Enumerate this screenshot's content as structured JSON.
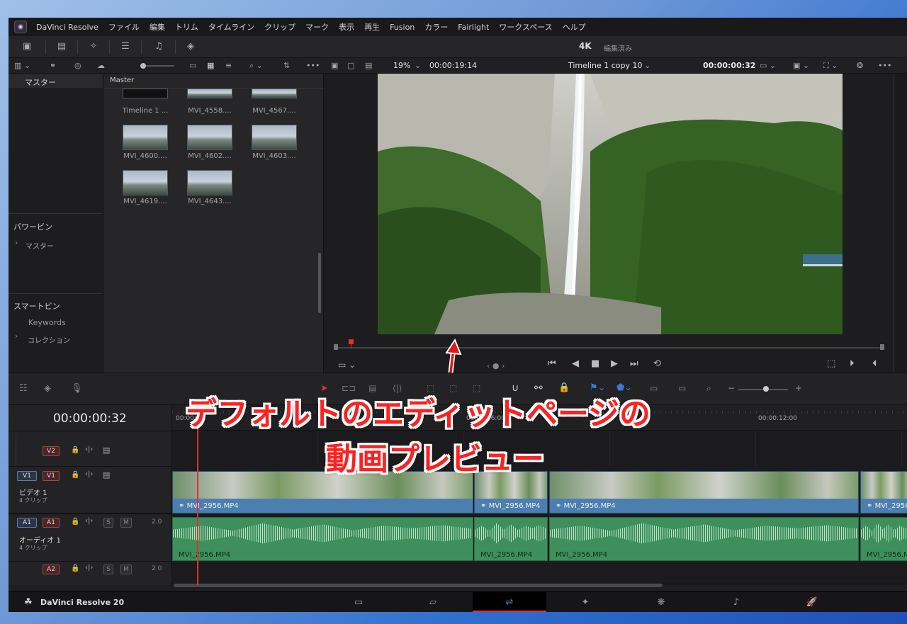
{
  "menu": {
    "app": "DaVinci Resolve",
    "items": [
      "ファイル",
      "編集",
      "トリム",
      "タイムライン",
      "クリップ",
      "マーク",
      "表示",
      "再生",
      "Fusion",
      "カラー",
      "Fairlight",
      "ワークスペース",
      "ヘルプ"
    ]
  },
  "header": {
    "resolution": "4K",
    "status": "編集済み"
  },
  "viewer": {
    "zoom": "19%",
    "source_timecode": "00:00:19:14",
    "timeline_name": "Timeline 1 copy 10",
    "timecode": "00:00:00:32"
  },
  "bins": {
    "master_label": "マスター",
    "bin_title": "Master",
    "power_bin_heading": "パワービン",
    "power_bin_item": "マスター",
    "smart_bin_heading": "スマートビン",
    "smart_items": [
      "Keywords",
      "コレクション"
    ],
    "clips": [
      "Timeline 1 ...",
      "MVI_4558....",
      "MVI_4567....",
      "MVI_4600....",
      "MVI_4602....",
      "MVI_4603....",
      "MVI_4619....",
      "MVI_4643...."
    ]
  },
  "timeline": {
    "timecode": "00:00:00:32",
    "ruler": [
      "00:00:0",
      "00:00:06:00",
      "00:00:12:00"
    ],
    "tracks": {
      "v2": "V2",
      "v1": "V1",
      "v1_name": "ビデオ 1",
      "v1_count": "4 クリップ",
      "a1": "A1",
      "a1_name": "オーディオ 1",
      "a1_count": "4 クリップ",
      "a1_level": "2.0",
      "a2": "A2",
      "a2_level": "2.0",
      "solo": "S",
      "mute": "M"
    },
    "clip_name": "MVI_2956.MP4"
  },
  "footer": {
    "app_version": "DaVinci Resolve 20"
  },
  "annotation": {
    "line1": "デフォルトのエディットページの",
    "line2": "動画プレビュー"
  },
  "colors": {
    "accent_red": "#ff2020",
    "video_clip": "#4a7fb0",
    "audio_clip": "#3e8f5c",
    "playhead": "#e03030"
  }
}
